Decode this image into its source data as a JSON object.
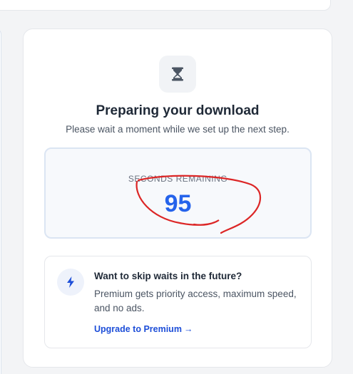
{
  "download": {
    "title": "Preparing your download",
    "subtitle": "Please wait a moment while we set up the next step."
  },
  "timer": {
    "label": "SECONDS REMAINING",
    "value": "95"
  },
  "premium": {
    "title": "Want to skip waits in the future?",
    "text": "Premium gets priority access, maximum speed, and no ads.",
    "link_label": "Upgrade to Premium",
    "link_arrow": "→"
  },
  "icons": {
    "status": "hourglass-icon",
    "promo": "lightning-bolt-icon"
  },
  "colors": {
    "accent": "#2563eb",
    "annotation": "#dc2626"
  }
}
